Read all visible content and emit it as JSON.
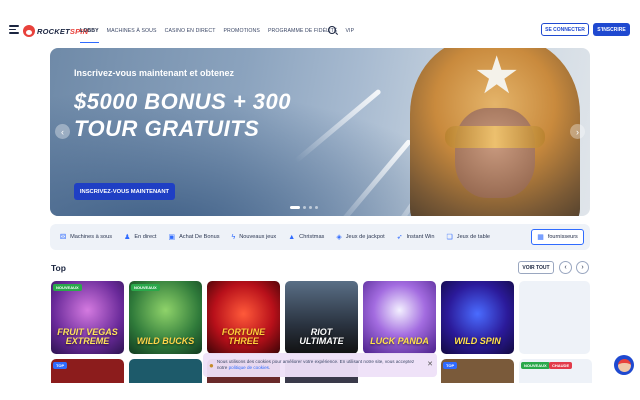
{
  "header": {
    "logo_text_a": "ROCKET",
    "logo_text_b": "SPIN",
    "nav": [
      "Lobby",
      "Machines à sous",
      "Casino en direct",
      "Promotions",
      "Programme de fidélité",
      "VIP"
    ],
    "login_label": "SE CONNECTER",
    "signup_label": "S'INSCRIRE"
  },
  "hero": {
    "subtitle": "Inscrivez-vous maintenant et obtenez",
    "title": "$5000 BONUS + 300 TOUR GRATUITS",
    "cta": "INSCRIVEZ-VOUS MAINTENANT",
    "active_slide": 1,
    "slide_count": 4
  },
  "categories": [
    {
      "icon": "slot-machine-icon",
      "label": "Machines à sous"
    },
    {
      "icon": "live-icon",
      "label": "En direct"
    },
    {
      "icon": "buy-bonus-icon",
      "label": "Achat De Bonus"
    },
    {
      "icon": "lightning-icon",
      "label": "Nouveaux jeux"
    },
    {
      "icon": "tree-icon",
      "label": "Christmas"
    },
    {
      "icon": "jackpot-icon",
      "label": "Jeux de jackpot"
    },
    {
      "icon": "rocket-icon",
      "label": "Instant Win"
    },
    {
      "icon": "cards-icon",
      "label": "Jeux de table"
    }
  ],
  "providers_label": "fournisseurs",
  "top": {
    "title": "Top",
    "see_all": "VOIR TOUT",
    "games": [
      {
        "label": "Fruit Vegas Extreme",
        "badge": "NOUVEAUX"
      },
      {
        "label": "Wild Bucks",
        "badge": "NOUVEAUX"
      },
      {
        "label": "Fortune Three",
        "badge": ""
      },
      {
        "label": "Riot Ultimate",
        "badge": ""
      },
      {
        "label": "Luck Panda",
        "badge": ""
      },
      {
        "label": "Wild Spin",
        "badge": ""
      }
    ],
    "row2_badges": [
      "TOP",
      "",
      "",
      "",
      "TOP",
      "NOUVEAUX",
      "CHAUDE"
    ]
  },
  "cookie": {
    "text": "Nous utilisons des cookies pour améliorer votre expérience. En utilisant notre site, vous acceptez notre ",
    "link": "politique de cookies",
    "tail": "."
  },
  "colors": {
    "brand_blue": "#1f49d0",
    "accent_red": "#e8413b",
    "category_bg": "#eef2f8"
  }
}
